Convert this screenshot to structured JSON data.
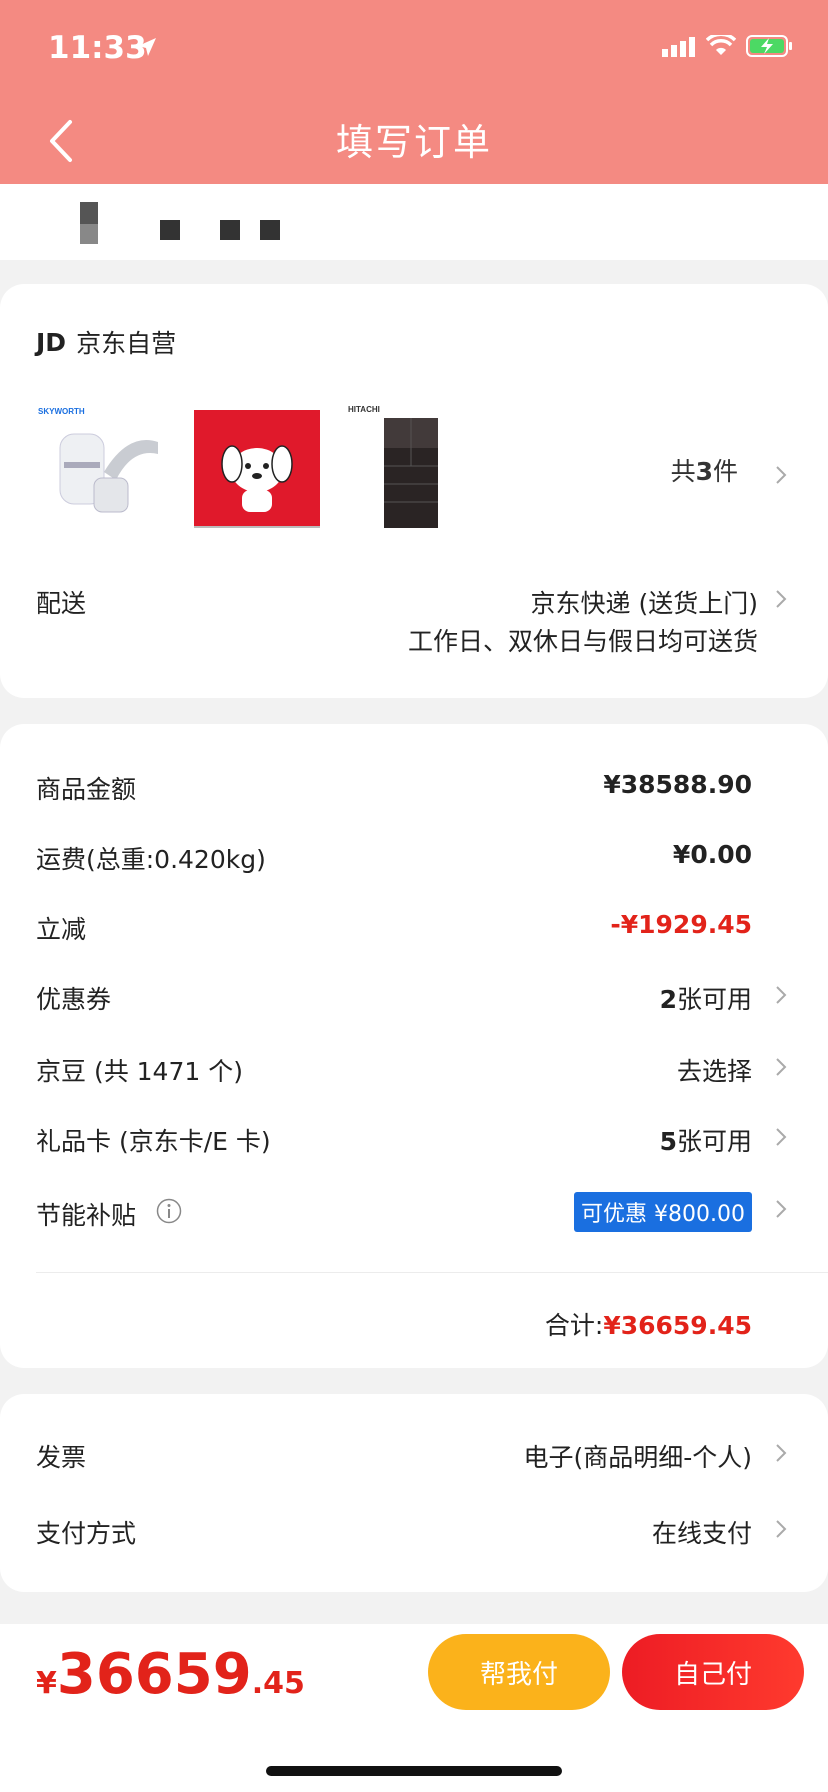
{
  "status_bar": {
    "time": "11:33"
  },
  "header": {
    "title": "填写订单"
  },
  "shop": {
    "logo": "JD",
    "name": "京东自营",
    "products": [
      {
        "name": "SKYWORTH 创维 净水龙头",
        "brand": "SKYWORTH"
      },
      {
        "name": "京东 JD 红色礼盒",
        "brand": "JD"
      },
      {
        "name": "HITACHI 日立 冰箱",
        "brand": "HITACHI"
      }
    ],
    "count_prefix": "共",
    "count": "3",
    "count_suffix": "件"
  },
  "delivery": {
    "label": "配送",
    "method": "京东快递 (送货上门)",
    "note": "工作日、双休日与假日均可送货"
  },
  "summary": {
    "rows": [
      {
        "label": "商品金额",
        "value": "¥38588.90"
      },
      {
        "label": "运费(总重:0.420kg)",
        "value": "¥0.00"
      },
      {
        "label": "立减",
        "value": "-¥1929.45"
      },
      {
        "label": "优惠券",
        "value_num": "2",
        "value_text": "张可用"
      },
      {
        "label": "京豆 (共 1471 个)",
        "value": "去选择"
      },
      {
        "label": "礼品卡 (京东卡/E 卡)",
        "value_num": "5",
        "value_text": "张可用"
      },
      {
        "label": "节能补贴",
        "value": "可优惠 ¥800.00"
      }
    ],
    "total_label": "合计:",
    "total_value": "¥36659.45"
  },
  "invoice": {
    "label": "发票",
    "value": "电子(商品明细-个人)"
  },
  "payment": {
    "label": "支付方式",
    "value": "在线支付"
  },
  "bottom": {
    "currency": "¥",
    "price_int": "36659",
    "price_dec": ".45",
    "help_pay": "帮我付",
    "self_pay": "自己付"
  },
  "colors": {
    "header": "#f48a82",
    "accent_red": "#e2231a",
    "help_button": "#fbb21b",
    "subsidy_blue": "#1a6fe0"
  }
}
